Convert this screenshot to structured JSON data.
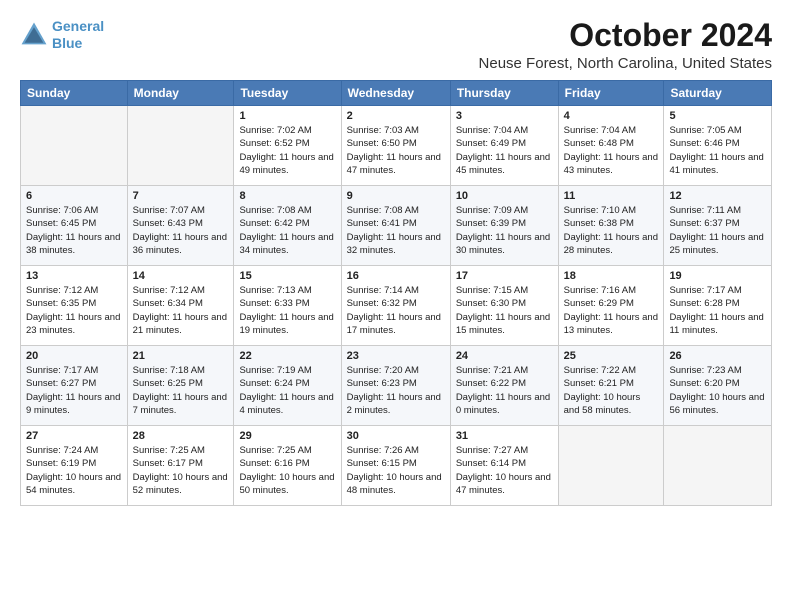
{
  "logo": {
    "line1": "General",
    "line2": "Blue"
  },
  "title": "October 2024",
  "subtitle": "Neuse Forest, North Carolina, United States",
  "days_of_week": [
    "Sunday",
    "Monday",
    "Tuesday",
    "Wednesday",
    "Thursday",
    "Friday",
    "Saturday"
  ],
  "weeks": [
    [
      {
        "day": "",
        "info": ""
      },
      {
        "day": "",
        "info": ""
      },
      {
        "day": "1",
        "info": "Sunrise: 7:02 AM\nSunset: 6:52 PM\nDaylight: 11 hours and 49 minutes."
      },
      {
        "day": "2",
        "info": "Sunrise: 7:03 AM\nSunset: 6:50 PM\nDaylight: 11 hours and 47 minutes."
      },
      {
        "day": "3",
        "info": "Sunrise: 7:04 AM\nSunset: 6:49 PM\nDaylight: 11 hours and 45 minutes."
      },
      {
        "day": "4",
        "info": "Sunrise: 7:04 AM\nSunset: 6:48 PM\nDaylight: 11 hours and 43 minutes."
      },
      {
        "day": "5",
        "info": "Sunrise: 7:05 AM\nSunset: 6:46 PM\nDaylight: 11 hours and 41 minutes."
      }
    ],
    [
      {
        "day": "6",
        "info": "Sunrise: 7:06 AM\nSunset: 6:45 PM\nDaylight: 11 hours and 38 minutes."
      },
      {
        "day": "7",
        "info": "Sunrise: 7:07 AM\nSunset: 6:43 PM\nDaylight: 11 hours and 36 minutes."
      },
      {
        "day": "8",
        "info": "Sunrise: 7:08 AM\nSunset: 6:42 PM\nDaylight: 11 hours and 34 minutes."
      },
      {
        "day": "9",
        "info": "Sunrise: 7:08 AM\nSunset: 6:41 PM\nDaylight: 11 hours and 32 minutes."
      },
      {
        "day": "10",
        "info": "Sunrise: 7:09 AM\nSunset: 6:39 PM\nDaylight: 11 hours and 30 minutes."
      },
      {
        "day": "11",
        "info": "Sunrise: 7:10 AM\nSunset: 6:38 PM\nDaylight: 11 hours and 28 minutes."
      },
      {
        "day": "12",
        "info": "Sunrise: 7:11 AM\nSunset: 6:37 PM\nDaylight: 11 hours and 25 minutes."
      }
    ],
    [
      {
        "day": "13",
        "info": "Sunrise: 7:12 AM\nSunset: 6:35 PM\nDaylight: 11 hours and 23 minutes."
      },
      {
        "day": "14",
        "info": "Sunrise: 7:12 AM\nSunset: 6:34 PM\nDaylight: 11 hours and 21 minutes."
      },
      {
        "day": "15",
        "info": "Sunrise: 7:13 AM\nSunset: 6:33 PM\nDaylight: 11 hours and 19 minutes."
      },
      {
        "day": "16",
        "info": "Sunrise: 7:14 AM\nSunset: 6:32 PM\nDaylight: 11 hours and 17 minutes."
      },
      {
        "day": "17",
        "info": "Sunrise: 7:15 AM\nSunset: 6:30 PM\nDaylight: 11 hours and 15 minutes."
      },
      {
        "day": "18",
        "info": "Sunrise: 7:16 AM\nSunset: 6:29 PM\nDaylight: 11 hours and 13 minutes."
      },
      {
        "day": "19",
        "info": "Sunrise: 7:17 AM\nSunset: 6:28 PM\nDaylight: 11 hours and 11 minutes."
      }
    ],
    [
      {
        "day": "20",
        "info": "Sunrise: 7:17 AM\nSunset: 6:27 PM\nDaylight: 11 hours and 9 minutes."
      },
      {
        "day": "21",
        "info": "Sunrise: 7:18 AM\nSunset: 6:25 PM\nDaylight: 11 hours and 7 minutes."
      },
      {
        "day": "22",
        "info": "Sunrise: 7:19 AM\nSunset: 6:24 PM\nDaylight: 11 hours and 4 minutes."
      },
      {
        "day": "23",
        "info": "Sunrise: 7:20 AM\nSunset: 6:23 PM\nDaylight: 11 hours and 2 minutes."
      },
      {
        "day": "24",
        "info": "Sunrise: 7:21 AM\nSunset: 6:22 PM\nDaylight: 11 hours and 0 minutes."
      },
      {
        "day": "25",
        "info": "Sunrise: 7:22 AM\nSunset: 6:21 PM\nDaylight: 10 hours and 58 minutes."
      },
      {
        "day": "26",
        "info": "Sunrise: 7:23 AM\nSunset: 6:20 PM\nDaylight: 10 hours and 56 minutes."
      }
    ],
    [
      {
        "day": "27",
        "info": "Sunrise: 7:24 AM\nSunset: 6:19 PM\nDaylight: 10 hours and 54 minutes."
      },
      {
        "day": "28",
        "info": "Sunrise: 7:25 AM\nSunset: 6:17 PM\nDaylight: 10 hours and 52 minutes."
      },
      {
        "day": "29",
        "info": "Sunrise: 7:25 AM\nSunset: 6:16 PM\nDaylight: 10 hours and 50 minutes."
      },
      {
        "day": "30",
        "info": "Sunrise: 7:26 AM\nSunset: 6:15 PM\nDaylight: 10 hours and 48 minutes."
      },
      {
        "day": "31",
        "info": "Sunrise: 7:27 AM\nSunset: 6:14 PM\nDaylight: 10 hours and 47 minutes."
      },
      {
        "day": "",
        "info": ""
      },
      {
        "day": "",
        "info": ""
      }
    ]
  ]
}
